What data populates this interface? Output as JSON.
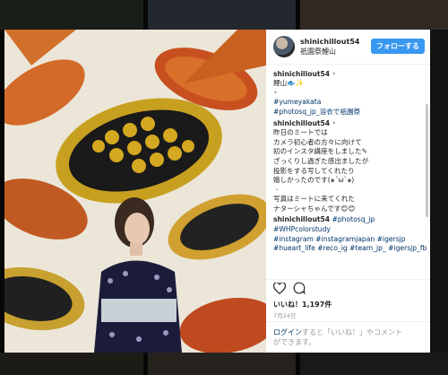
{
  "post": {
    "username": "shinichillout54",
    "location": "祇園祭鯉山",
    "follow_label": "フォローする"
  },
  "caption": {
    "username": "shinichillout54",
    "text": "鯉山🐟✨",
    "tags": [
      "#yumeyakata",
      "#photosq_jp_浴衣で祇園祭"
    ]
  },
  "comments": [
    {
      "username": "shinichillout54",
      "lines": [
        "昨日のミートでは",
        "カメラ初心者の方々に向けて",
        "初のインスタ講座をしました✎",
        "ざっくりし過ぎた感出ましたが",
        "投影をする写してくれたり",
        "嬉しかったのです(๑´ω`๑)",
        "・",
        "写真はミートに来てくれた",
        "ナターシャちゃんです😊😊"
      ]
    },
    {
      "username": "shinichillout54",
      "first_tag": "#photosq_jp",
      "tag_lines": [
        "#WHPcolorstudy",
        "#instagram #instagramjapan #igersjp",
        "#hueart_life #reco_ig #team_jp_ #igersjp_fb"
      ]
    }
  ],
  "likes_text": "いいね！1,197件",
  "date": "7月24日",
  "login_prompt": {
    "login_link": "ログイン",
    "rest": "すると「いいね！」やコメント",
    "rest2": "ができます。"
  },
  "icons": [
    "heart-icon",
    "comment-icon"
  ]
}
